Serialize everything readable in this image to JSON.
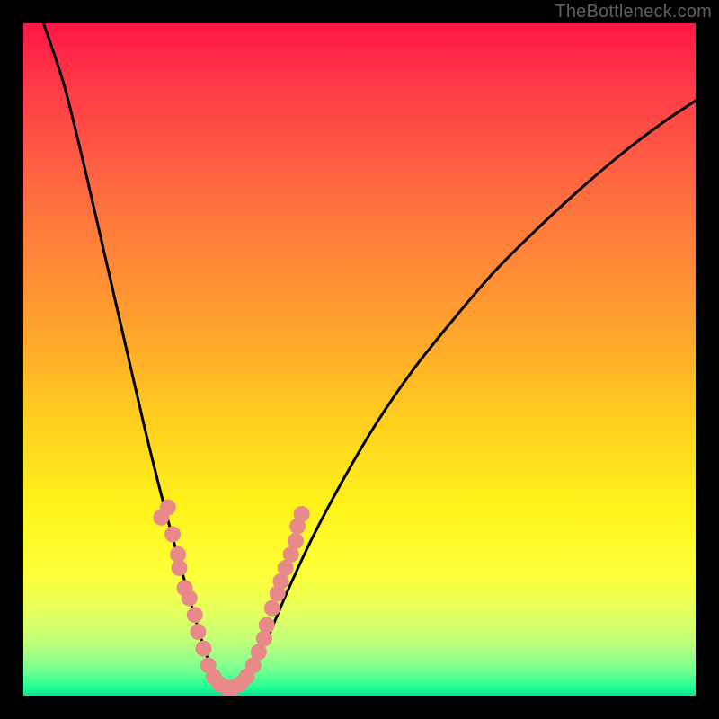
{
  "watermark": "TheBottleneck.com",
  "chart_data": {
    "type": "line",
    "title": "",
    "xlabel": "",
    "ylabel": "",
    "xlim": [
      0,
      1
    ],
    "ylim": [
      0,
      1
    ],
    "description": "V-shaped bottleneck curve on red-to-green vertical gradient. Minimum near x≈0.30 at bottom (green). Left branch rises steeply to top-left; right branch rises with decreasing slope toward upper right.",
    "curve_points_normalized": [
      [
        0.03,
        0.0
      ],
      [
        0.06,
        0.09
      ],
      [
        0.09,
        0.21
      ],
      [
        0.12,
        0.34
      ],
      [
        0.15,
        0.47
      ],
      [
        0.18,
        0.6
      ],
      [
        0.21,
        0.72
      ],
      [
        0.24,
        0.83
      ],
      [
        0.26,
        0.9
      ],
      [
        0.28,
        0.96
      ],
      [
        0.3,
        0.988
      ],
      [
        0.32,
        0.988
      ],
      [
        0.34,
        0.96
      ],
      [
        0.365,
        0.91
      ],
      [
        0.395,
        0.84
      ],
      [
        0.43,
        0.765
      ],
      [
        0.475,
        0.68
      ],
      [
        0.525,
        0.595
      ],
      [
        0.58,
        0.515
      ],
      [
        0.64,
        0.44
      ],
      [
        0.7,
        0.37
      ],
      [
        0.765,
        0.305
      ],
      [
        0.83,
        0.245
      ],
      [
        0.895,
        0.19
      ],
      [
        0.955,
        0.145
      ],
      [
        1.0,
        0.115
      ]
    ],
    "dot_clusters_normalized": [
      [
        0.205,
        0.735
      ],
      [
        0.215,
        0.72
      ],
      [
        0.222,
        0.76
      ],
      [
        0.23,
        0.79
      ],
      [
        0.232,
        0.81
      ],
      [
        0.24,
        0.84
      ],
      [
        0.247,
        0.855
      ],
      [
        0.255,
        0.88
      ],
      [
        0.26,
        0.905
      ],
      [
        0.268,
        0.93
      ],
      [
        0.275,
        0.955
      ],
      [
        0.283,
        0.972
      ],
      [
        0.292,
        0.983
      ],
      [
        0.302,
        0.988
      ],
      [
        0.312,
        0.988
      ],
      [
        0.322,
        0.983
      ],
      [
        0.332,
        0.972
      ],
      [
        0.342,
        0.955
      ],
      [
        0.35,
        0.935
      ],
      [
        0.358,
        0.915
      ],
      [
        0.362,
        0.895
      ],
      [
        0.37,
        0.87
      ],
      [
        0.378,
        0.848
      ],
      [
        0.383,
        0.83
      ],
      [
        0.39,
        0.81
      ],
      [
        0.398,
        0.79
      ],
      [
        0.405,
        0.77
      ],
      [
        0.408,
        0.748
      ],
      [
        0.414,
        0.73
      ]
    ],
    "colors": {
      "curve": "#000000",
      "dots": "#e88a8a",
      "gradient_top": "#ff1744",
      "gradient_bottom": "#00e690",
      "frame": "#000000"
    }
  }
}
